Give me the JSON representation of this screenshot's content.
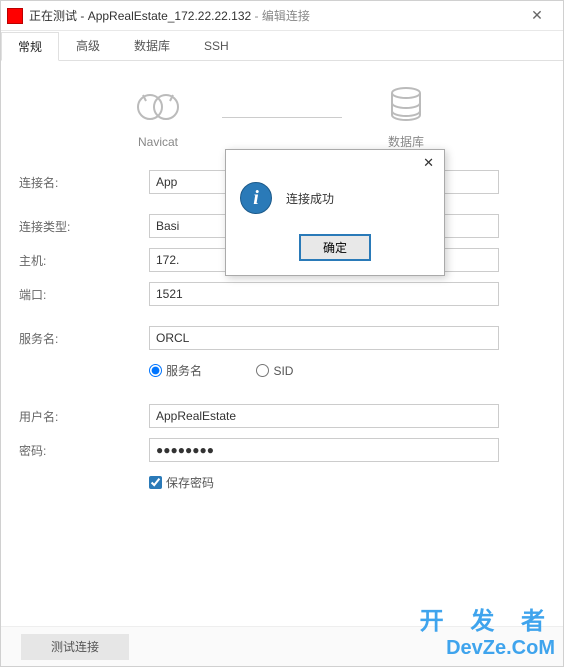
{
  "title": {
    "status": "正在测试",
    "name": "AppRealEstate_172.22.22.132",
    "mode": "编辑连接"
  },
  "tabs": [
    "常规",
    "高级",
    "数据库",
    "SSH"
  ],
  "diagram": {
    "left": "Navicat",
    "right": "数据库"
  },
  "labels": {
    "conn_name": "连接名:",
    "conn_type": "连接类型:",
    "host": "主机:",
    "port": "端口:",
    "service": "服务名:",
    "user": "用户名:",
    "pass": "密码:"
  },
  "values": {
    "conn_name": "App",
    "conn_type": "Basi",
    "host": "172.",
    "port": "1521",
    "service": "ORCL",
    "user": "AppRealEstate",
    "pass": "●●●●●●●●"
  },
  "radios": {
    "service": "服务名",
    "sid": "SID"
  },
  "checks": {
    "save_pass": "保存密码"
  },
  "footer": {
    "test": "测试连接"
  },
  "modal": {
    "message": "连接成功",
    "ok": "确定"
  },
  "watermark": {
    "line1": "开 发 者",
    "line2": "DevZe.CoM"
  }
}
